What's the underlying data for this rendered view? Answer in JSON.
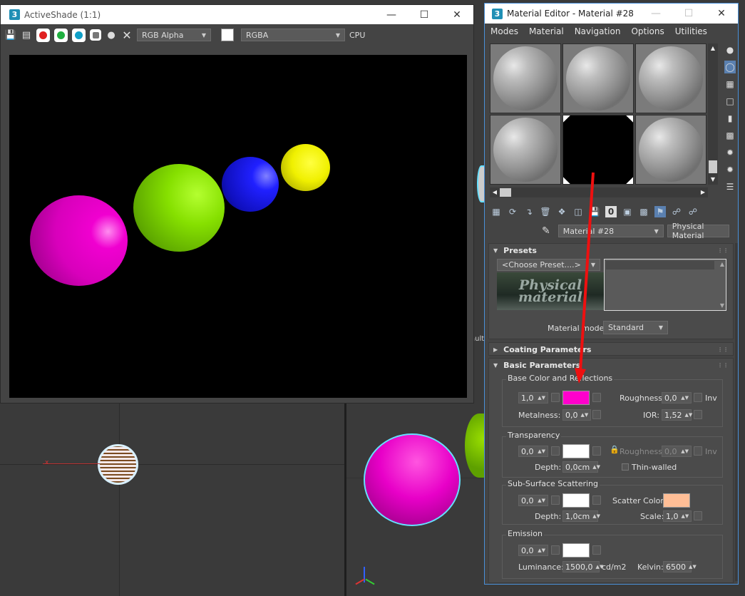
{
  "colors": {
    "accent": "#4a90d9",
    "base_color": "#ff00cc",
    "scatter_color": "#ffbe96",
    "transparency_color": "#ffffff",
    "emission_color": "#ffffff"
  },
  "activeshade": {
    "title": "ActiveShade (1:1)",
    "channel": "RGB Alpha",
    "display": "RGBA",
    "renderer": "CPU",
    "balls": [
      {
        "color": "magenta"
      },
      {
        "color": "lime"
      },
      {
        "color": "blue"
      },
      {
        "color": "yellow"
      }
    ]
  },
  "editor": {
    "title": "Material Editor - Material #28",
    "menu": [
      "Modes",
      "Material",
      "Navigation",
      "Options",
      "Utilities"
    ],
    "material_name": "Material #28",
    "material_type": "Physical Material",
    "presets": {
      "header": "Presets",
      "choose": "<Choose Preset....>",
      "logo": "Physical material",
      "mode_label": "Material mode:",
      "mode_value": "Standard"
    },
    "coating": {
      "header": "Coating Parameters"
    },
    "basic": {
      "header": "Basic Parameters",
      "base": {
        "title": "Base Color and Reflections",
        "weight": "1,0",
        "roughness_label": "Roughness:",
        "roughness": "0,0",
        "inv": "Inv",
        "metalness_label": "Metalness:",
        "metalness": "0,0",
        "ior_label": "IOR:",
        "ior": "1,52"
      },
      "transparency": {
        "title": "Transparency",
        "weight": "0,0",
        "roughness_label": "Roughness:",
        "roughness": "0,0",
        "inv": "Inv",
        "depth_label": "Depth:",
        "depth": "0,0cm",
        "thin_walled": "Thin-walled"
      },
      "sss": {
        "title": "Sub-Surface Scattering",
        "weight": "0,0",
        "scatter_label": "Scatter Color:",
        "depth_label": "Depth:",
        "depth": "1,0cm",
        "scale_label": "Scale:",
        "scale": "1,0"
      },
      "emission": {
        "title": "Emission",
        "weight": "0,0",
        "luminance_label": "Luminance:",
        "luminance": "1500,0",
        "luminance_unit": "cd/m2",
        "kelvin_label": "Kelvin:",
        "kelvin": "6500"
      }
    }
  },
  "icons": [
    "save-icon",
    "copy-icon",
    "red-circle-icon",
    "green-circle-icon",
    "cyan-circle-icon",
    "mono-icon",
    "dot-icon",
    "clear-icon"
  ]
}
